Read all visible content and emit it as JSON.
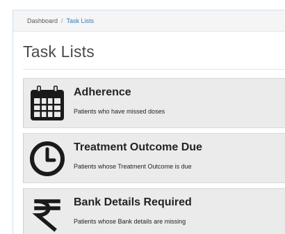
{
  "breadcrumb": {
    "home": "Dashboard",
    "separator": "/",
    "current": "Task Lists"
  },
  "page": {
    "title": "Task Lists"
  },
  "task_lists": [
    {
      "title": "Adherence",
      "description": "Patients who have missed doses",
      "icon": "calendar-icon"
    },
    {
      "title": "Treatment Outcome Due",
      "description": "Patients whose Treatment Outcome is due",
      "icon": "clock-icon"
    },
    {
      "title": "Bank Details Required",
      "description": "Patients whose Bank details are missing",
      "icon": "rupee-icon"
    }
  ],
  "colors": {
    "link": "#2f7bbf",
    "card_background": "#ebebeb",
    "text": "#222222"
  }
}
